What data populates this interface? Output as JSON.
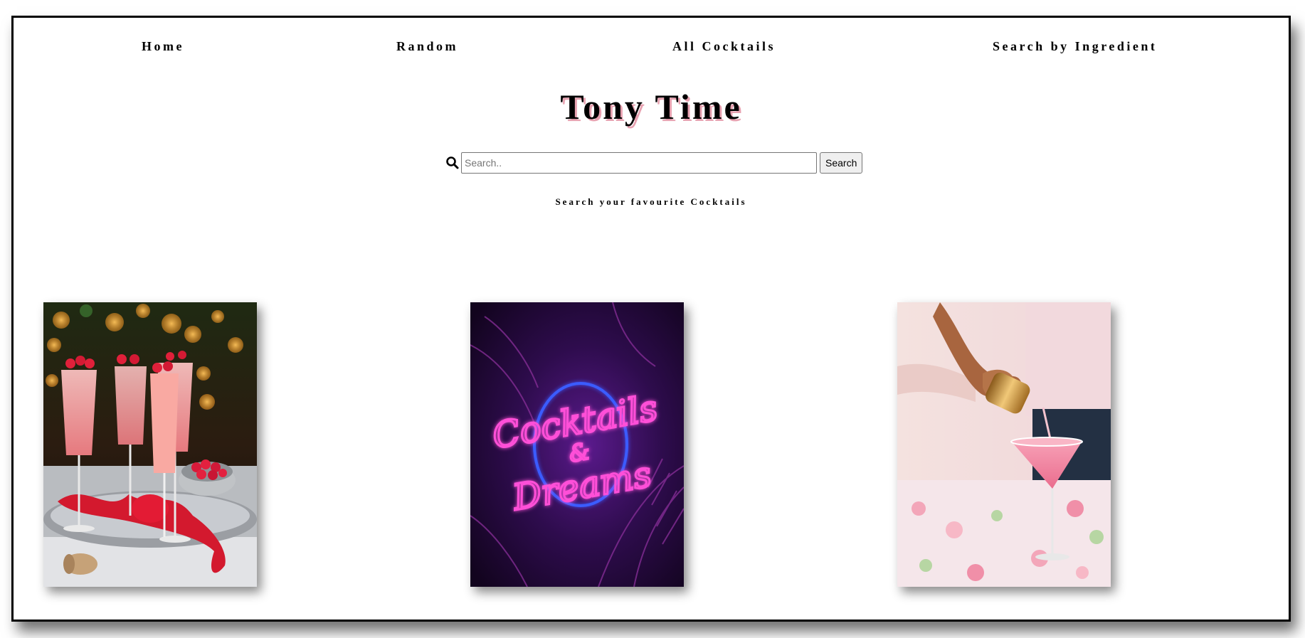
{
  "nav": {
    "items": [
      {
        "label": "Home"
      },
      {
        "label": "Random"
      },
      {
        "label": "All Cocktails"
      },
      {
        "label": "Search by Ingredient"
      }
    ]
  },
  "header": {
    "title": "Tony Time"
  },
  "search": {
    "placeholder": "Search..",
    "value": "",
    "button_label": "Search",
    "hint": "Search your favourite Cocktails"
  },
  "gallery": {
    "neon_sign": {
      "line1": "Cocktails",
      "line2": "&",
      "line3": "Dreams"
    }
  },
  "colors": {
    "title_shadow": "#e7a1b0",
    "neon_pink": "#ff4fd8",
    "neon_blue": "#3a5bff"
  },
  "icons": {
    "search": "magnifying-glass-icon"
  }
}
